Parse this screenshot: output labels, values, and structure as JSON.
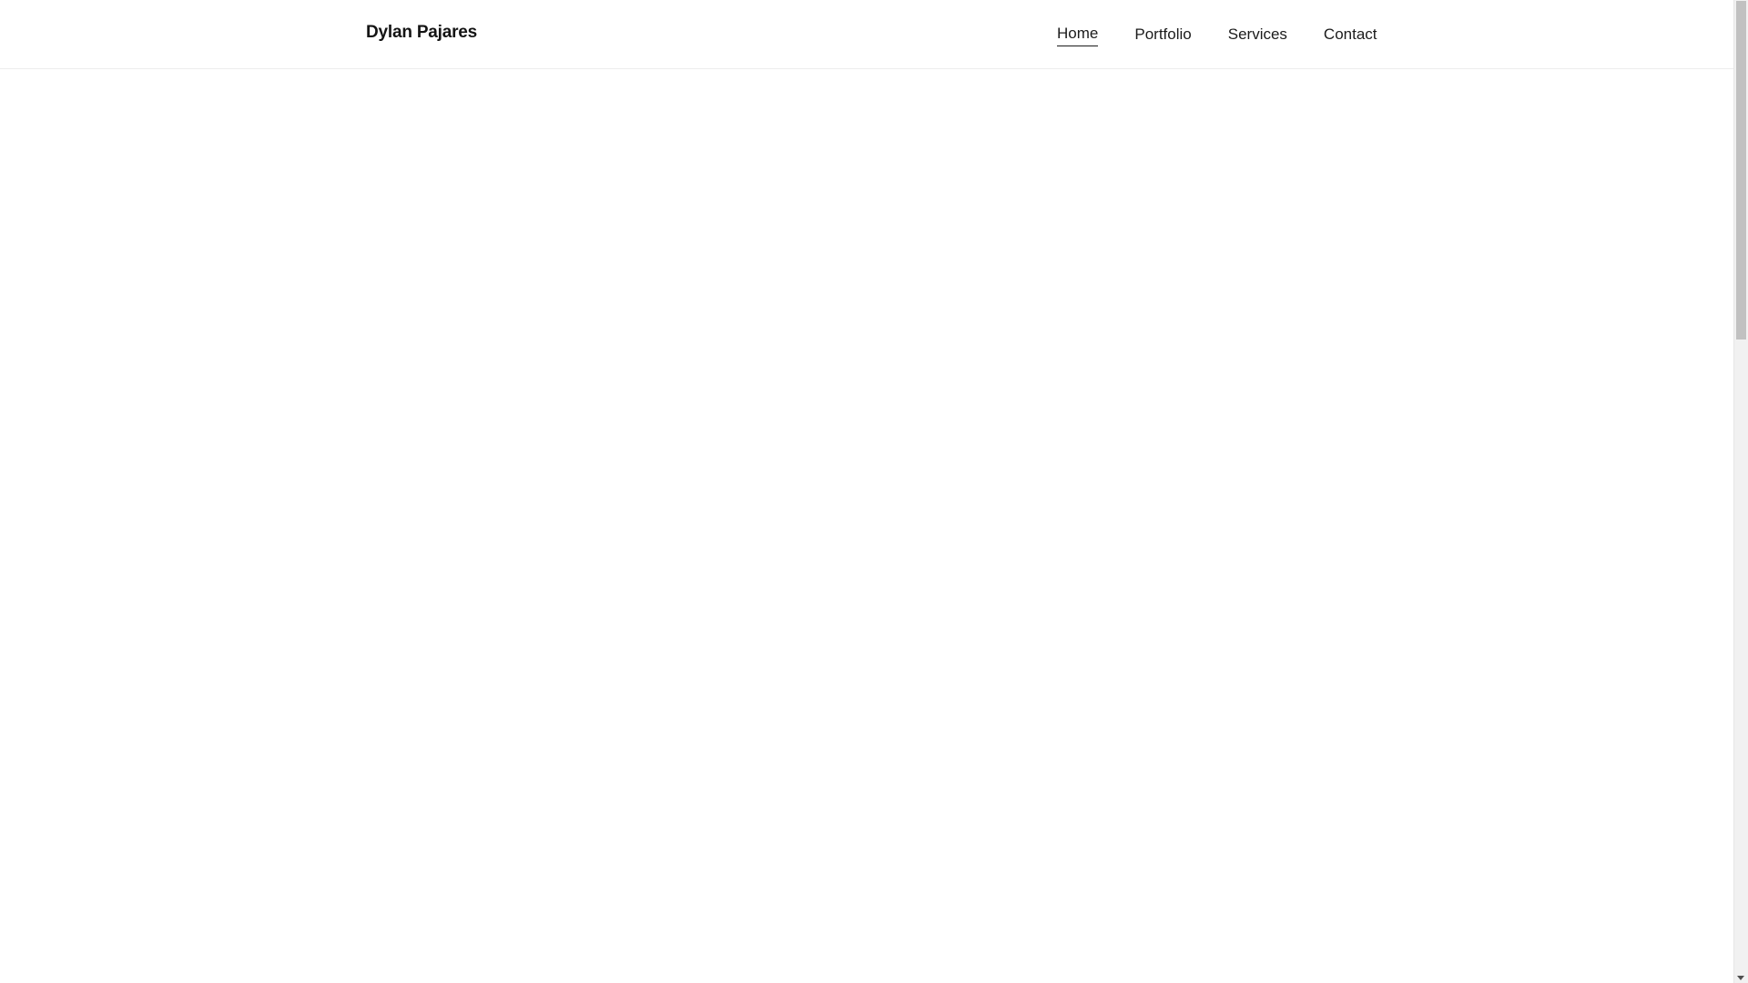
{
  "header": {
    "brand": "Dylan Pajares",
    "nav": [
      {
        "label": "Home",
        "active": true
      },
      {
        "label": "Portfolio",
        "active": false
      },
      {
        "label": "Services",
        "active": false
      },
      {
        "label": "Contact",
        "active": false
      }
    ]
  },
  "scrollbar": {
    "thumb_fraction": 0.35,
    "down_arrow_icon": "chevron-down-icon"
  },
  "colors": {
    "background": "#ffffff",
    "text": "#141414",
    "header_border": "#ececec",
    "scroll_thumb": "#c1c1c1"
  }
}
